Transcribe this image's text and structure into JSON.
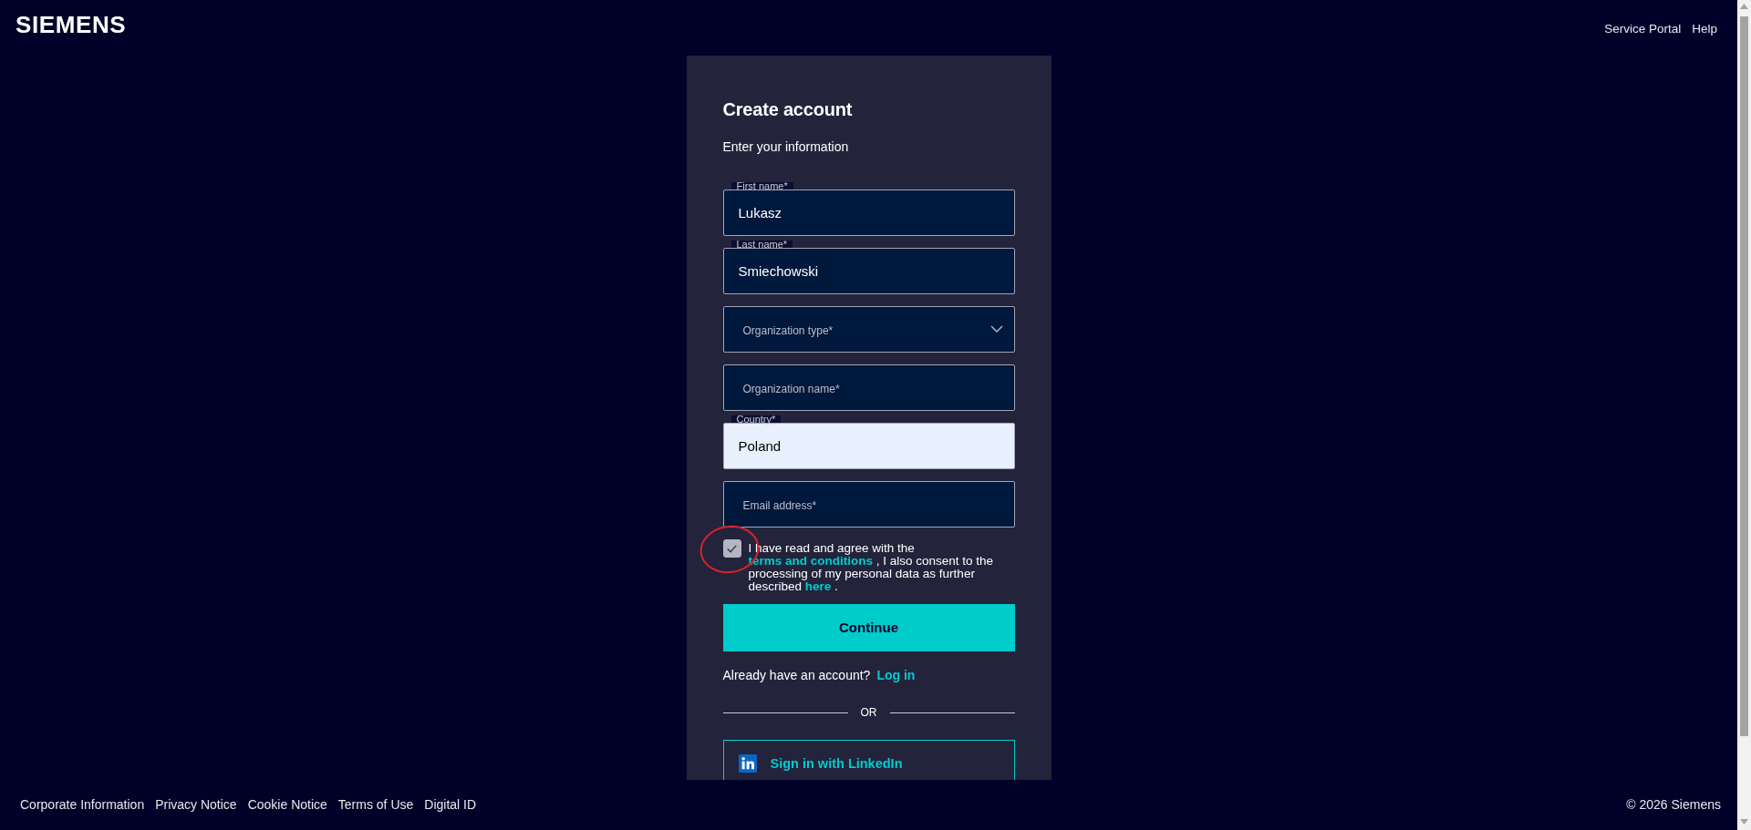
{
  "header": {
    "logo": "SIEMENS",
    "links": [
      "Service Portal",
      "Help"
    ]
  },
  "form": {
    "title": "Create account",
    "subtitle": "Enter your information",
    "fields": [
      {
        "kind": "text",
        "label": "First name*",
        "value": "Lukasz",
        "autofilled": false
      },
      {
        "kind": "text",
        "label": "Last name*",
        "value": "Smiechowski",
        "autofilled": false
      },
      {
        "kind": "select",
        "placeholder": "Organization type*"
      },
      {
        "kind": "text",
        "placeholder": "Organization name*",
        "autofilled": false
      },
      {
        "kind": "text",
        "label": "Country*",
        "value": "Poland",
        "autofilled": true
      },
      {
        "kind": "text",
        "placeholder": "Email address*",
        "autofilled": false
      }
    ],
    "consent": {
      "checked": true,
      "highlighted": true,
      "parts": [
        {
          "kind": "text",
          "text": "I have read and agree with the"
        },
        {
          "kind": "link",
          "text": "terms and conditions"
        },
        {
          "kind": "text",
          "text": ", I also consent to the processing of my personal data as further described"
        },
        {
          "kind": "link",
          "text": "here"
        },
        {
          "kind": "text",
          "text": "."
        }
      ]
    },
    "continue_button": "Continue",
    "login_prompt": {
      "text": "Already have an account?",
      "link": "Log in"
    },
    "divider": "OR",
    "linkedin_button": "Sign in with LinkedIn"
  },
  "footer": {
    "links": [
      "Corporate Information",
      "Privacy Notice",
      "Cookie Notice",
      "Terms of Use",
      "Digital ID"
    ],
    "copyright": "© 2026 Siemens"
  }
}
